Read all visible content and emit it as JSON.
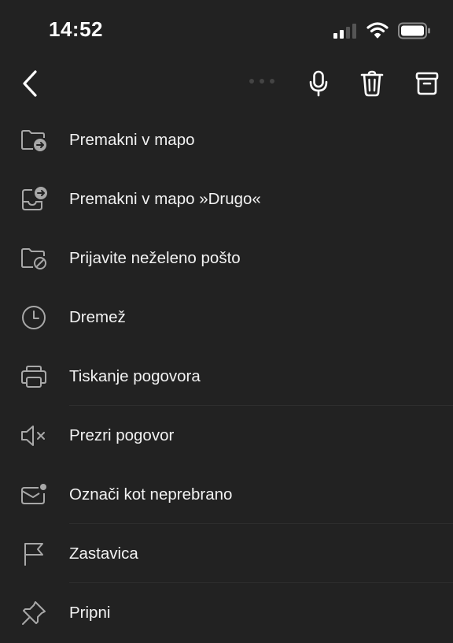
{
  "status_bar": {
    "time": "14:52",
    "icons": [
      "signal-icon",
      "wifi-icon",
      "battery-icon"
    ]
  },
  "toolbar": {
    "icons": [
      "back-chevron-icon",
      "more-dots-icon",
      "microphone-icon",
      "trash-icon",
      "archive-icon"
    ]
  },
  "menu": {
    "items": [
      {
        "label": "Premakni v mapo",
        "icon": "folder-move-icon"
      },
      {
        "label": "Premakni v mapo »Drugo«",
        "icon": "inbox-move-icon"
      },
      {
        "label": "Prijavite neželeno pošto",
        "icon": "folder-block-icon"
      },
      {
        "label": "Dremež",
        "icon": "clock-icon"
      },
      {
        "label": "Tiskanje pogovora",
        "icon": "printer-icon"
      },
      {
        "label": "Prezri pogovor",
        "icon": "speaker-mute-icon"
      },
      {
        "label": "Označi kot neprebrano",
        "icon": "mail-unread-icon"
      },
      {
        "label": "Zastavica",
        "icon": "flag-icon"
      },
      {
        "label": "Pripni",
        "icon": "pin-icon"
      }
    ]
  },
  "colors": {
    "background": "#222222",
    "text": "#f2f2f2",
    "icon": "#a8a8a8",
    "toolbar_icon": "#ffffff",
    "separator": "#2e2e2e"
  }
}
